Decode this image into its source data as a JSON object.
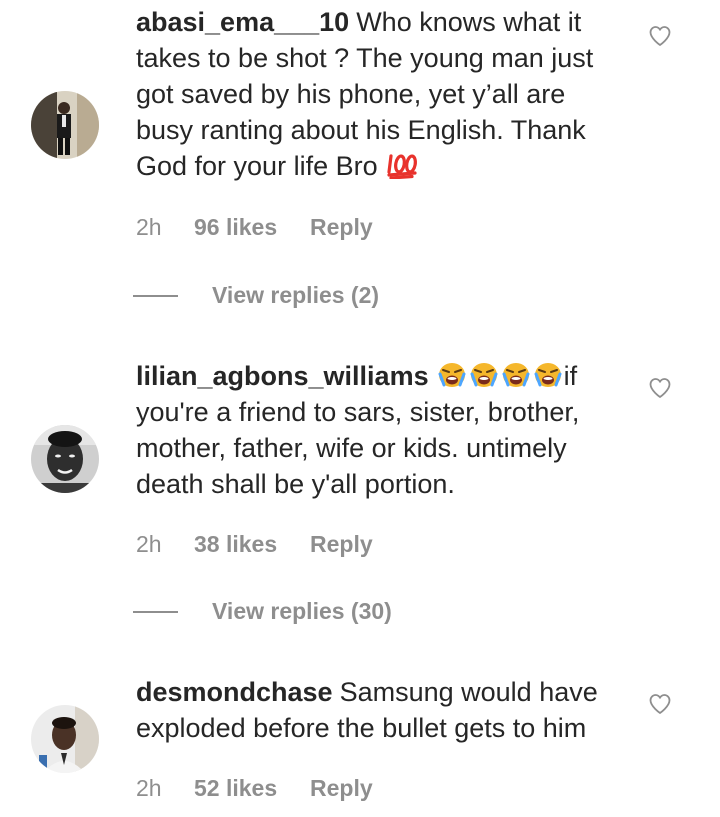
{
  "comments": [
    {
      "username": "abasi_ema___10",
      "text_parts": [
        "Who knows what it takes to be shot ? The young man just got saved by his phone, yet y’all are busy ranting about his English. Thank God for your life Bro "
      ],
      "emoji": "hundred-points-emoji",
      "time": "2h",
      "likes": "96 likes",
      "reply_label": "Reply",
      "view_replies": "View replies (2)"
    },
    {
      "username": "lilian_agbons_williams",
      "emojis": [
        "loudly-crying-face-emoji",
        "loudly-crying-face-emoji",
        "loudly-crying-face-emoji",
        "loudly-crying-face-emoji"
      ],
      "text": "if you're a friend to sars, sister, brother, mother, father, wife or kids. untimely death shall be y'all portion.",
      "time": "2h",
      "likes": "38 likes",
      "reply_label": "Reply",
      "view_replies": "View replies (30)"
    },
    {
      "username": "desmondchase",
      "text": "Samsung would have exploded before the bullet gets to him",
      "time": "2h",
      "likes": "52 likes",
      "reply_label": "Reply"
    }
  ],
  "icons": {
    "like": "heart-outline-icon"
  },
  "colors": {
    "text": "#262626",
    "secondary": "#8e8e8e",
    "emoji_red": "#e8322c",
    "emoji_yellow": "#f5b72c"
  }
}
